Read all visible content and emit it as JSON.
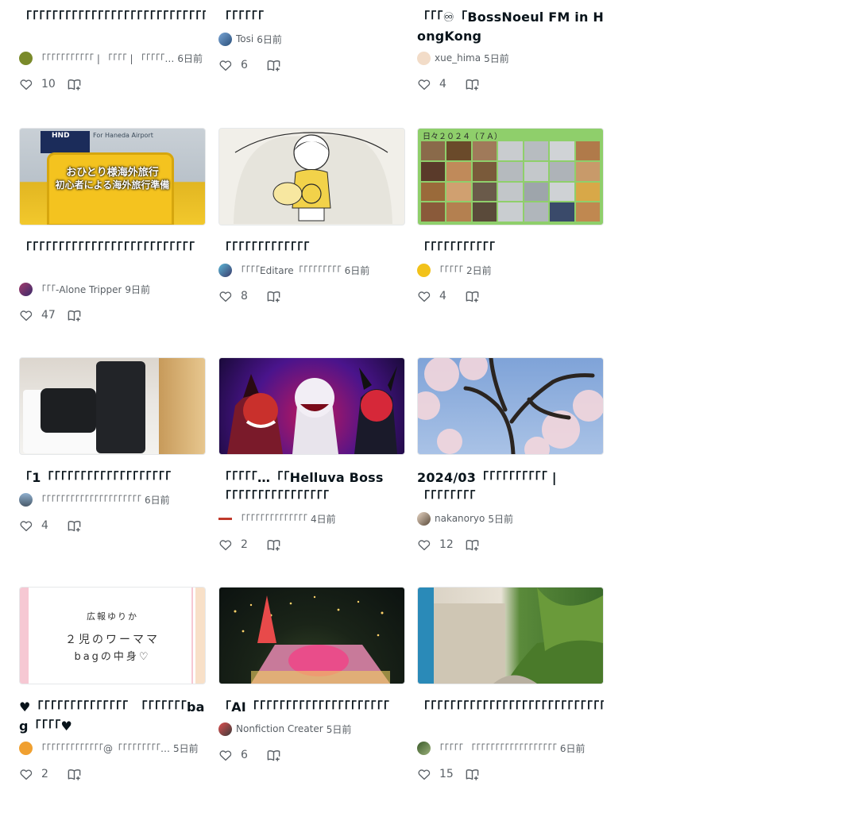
{
  "cards": [
    {
      "title": "「「「「「「「「「「「「「「「「「「「「「「「「「「「「「「「「「「「「「「「「「「「「「「",
      "author": "「「「「「「「「「「「 | 「「「「 | 「「「「「…",
      "time": "6日前",
      "likes": "10"
    },
    {
      "title": "「「「「「「",
      "author": "Tosi",
      "time": "6日前",
      "likes": "6"
    },
    {
      "title": "「「「♾「BossNoeul FM in HongKong",
      "author": "xue_hima",
      "time": "5日前",
      "likes": "4"
    },
    {
      "title": "「「「「「「「「「「「「「「「「「「「「「「「「「「",
      "author": "「「「-Alone Tripper",
      "time": "9日前",
      "likes": "47"
    },
    {
      "title": "「「「「「「「「「「「「「",
      "author": "「「「「Editare「「「「「「「「「",
      "time": "6日前",
      "likes": "8"
    },
    {
      "title": "「「「「「「「「「「「",
      "author": "「「「「「",
      "time": "2日前",
      "likes": "4"
    },
    {
      "title": "「1「「「「「「「「「「「「「「「「「「「",
      "author": "「「「「「「「「「「「「「「「「「「「「「",
      "time": "6日前",
      "likes": "4"
    },
    {
      "title": "「「「「「…「「Helluva Boss「「「「「「「「「「「「「「「「",
      "author": "「「「「「「「「「「「「「「",
      "time": "4日前",
      "likes": "2"
    },
    {
      "title": "2024/03「「「「「「「「「「 | 「「「「「「「「",
      "author": "nakanoryo",
      "time": "5日前",
      "likes": "12"
    },
    {
      "title": "♥「「「「「「「「「「「「「「　「「「「「「「bag「「「「♥",
      "author": "「「「「「「「「「「「「「@「「「「「「「「「…",
      "time": "5日前",
      "likes": "2"
    },
    {
      "title": "「AI「「「「「「「「「「「「「「「「「「「「「",
      "author": "Nonfiction Creater",
      "time": "5日前",
      "likes": "6"
    },
    {
      "title": "「「「「「「「「「「「「「「「「「「「「「「「「「「「「「「「「「「「「",
      "author": "「「「「「 「「「「「「「「「「「「「「「「「「",
      "time": "6日前",
      "likes": "15"
    }
  ],
  "thumb_text": {
    "luggage_line1": "おひとり様海外旅行",
    "luggage_line2": "初心者による海外旅行準備",
    "luggage_sign": "HND",
    "luggage_sign2": "For Haneda Airport",
    "diary": "日々２０２４（７Ａ）",
    "pink_line1": "広報ゆりか",
    "pink_line2": "２児のワーママ",
    "pink_line3": "bagの中身♡"
  },
  "colors": {
    "text": "#08131a",
    "muted": "#5a6066",
    "accent": "#2cb696"
  }
}
